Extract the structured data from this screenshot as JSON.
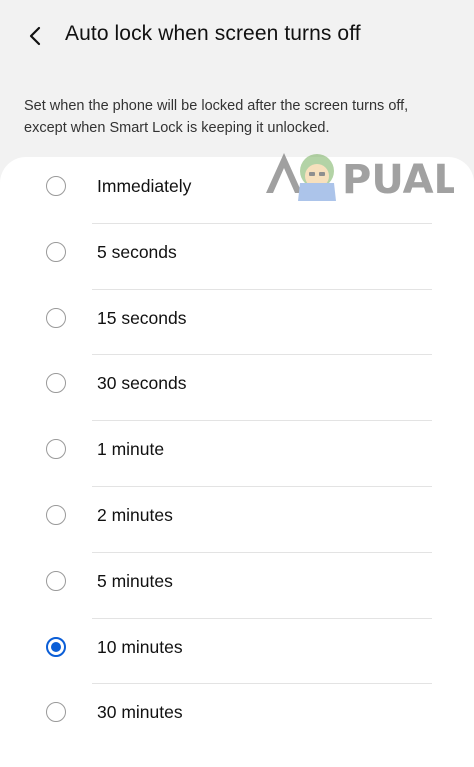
{
  "header": {
    "back_icon": "chevron-left-icon",
    "title": "Auto lock when screen turns off"
  },
  "description": "Set when the phone will be locked after the screen turns off, except when Smart Lock is keeping it unlocked.",
  "watermark": {
    "text": "APPUALS"
  },
  "options": [
    {
      "label": "Immediately",
      "selected": false
    },
    {
      "label": "5 seconds",
      "selected": false
    },
    {
      "label": "15 seconds",
      "selected": false
    },
    {
      "label": "30 seconds",
      "selected": false
    },
    {
      "label": "1 minute",
      "selected": false
    },
    {
      "label": "2 minutes",
      "selected": false
    },
    {
      "label": "5 minutes",
      "selected": false
    },
    {
      "label": "10 minutes",
      "selected": true
    },
    {
      "label": "30 minutes",
      "selected": false
    }
  ],
  "colors": {
    "accent": "#0b5ed7",
    "background": "#f2f2f2",
    "card": "#ffffff"
  }
}
